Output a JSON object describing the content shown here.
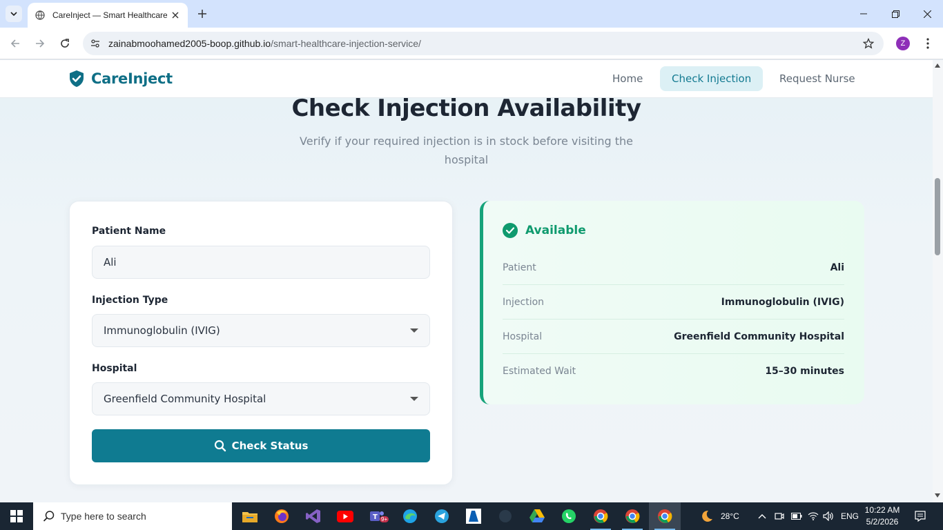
{
  "browser": {
    "tab_title": "CareInject — Smart Healthcare",
    "url_host": "zainabmoohamed2005-boop.github.io",
    "url_path": "/smart-healthcare-injection-service/",
    "profile_initial": "Z"
  },
  "site": {
    "brand": "CareInject",
    "nav": [
      {
        "label": "Home",
        "active": false
      },
      {
        "label": "Check Injection",
        "active": true
      },
      {
        "label": "Request Nurse",
        "active": false
      }
    ]
  },
  "hero": {
    "title": "Check Injection Availability",
    "subtitle": "Verify if your required injection is in stock before visiting the hospital"
  },
  "form": {
    "patient_label": "Patient Name",
    "patient_value": "Ali",
    "injection_label": "Injection Type",
    "injection_value": "Immunoglobulin (IVIG)",
    "hospital_label": "Hospital",
    "hospital_value": "Greenfield Community Hospital",
    "button_label": "Check Status"
  },
  "result": {
    "status": "Available",
    "rows": [
      {
        "key": "Patient",
        "value": "Ali"
      },
      {
        "key": "Injection",
        "value": "Immunoglobulin (IVIG)"
      },
      {
        "key": "Hospital",
        "value": "Greenfield Community Hospital"
      },
      {
        "key": "Estimated Wait",
        "value": "15–30 minutes"
      }
    ]
  },
  "taskbar": {
    "search_placeholder": "Type here to search",
    "weather": "28°C",
    "language": "ENG",
    "time": "10:22 AM",
    "date": "5/2/2026",
    "notif_count": "9+"
  },
  "colors": {
    "brand": "#0f6f86",
    "button": "#0f7b91",
    "success": "#0f9a6e"
  }
}
